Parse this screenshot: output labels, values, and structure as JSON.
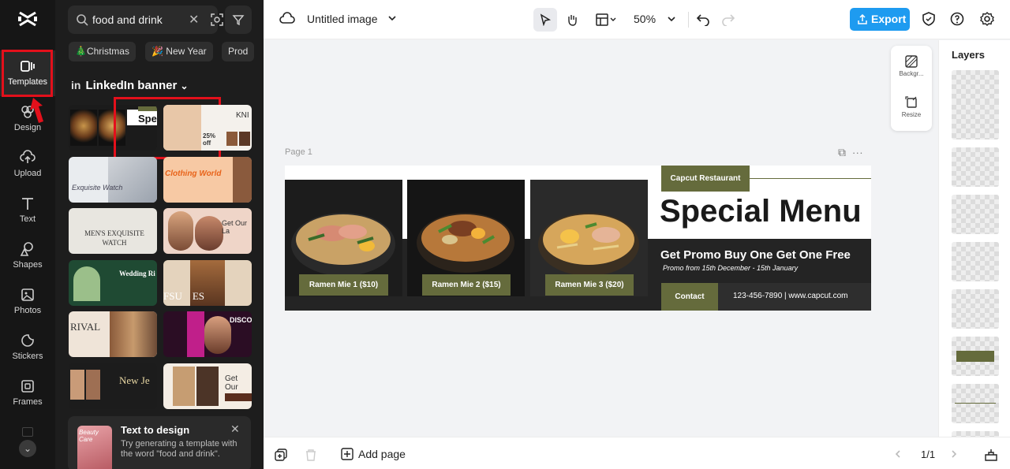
{
  "sidebar": {
    "items": [
      {
        "label": "Templates",
        "icon": "templates-icon"
      },
      {
        "label": "Design",
        "icon": "design-icon"
      },
      {
        "label": "Upload",
        "icon": "upload-icon"
      },
      {
        "label": "Text",
        "icon": "text-icon"
      },
      {
        "label": "Shapes",
        "icon": "shapes-icon"
      },
      {
        "label": "Photos",
        "icon": "photos-icon"
      },
      {
        "label": "Stickers",
        "icon": "stickers-icon"
      },
      {
        "label": "Frames",
        "icon": "frames-icon"
      }
    ]
  },
  "panel": {
    "search_value": "food and drink",
    "chips": [
      "🎄Christmas",
      "🎉 New Year",
      "Prod"
    ],
    "category": "LinkedIn banner",
    "thumbs": [
      {
        "text": "Spec"
      },
      {
        "text": "KNI"
      },
      {
        "text": "Exquisite Watch"
      },
      {
        "text": "Clothing World"
      },
      {
        "text": "MEN'S EXQUISITE WATCH"
      },
      {
        "text": "Get Our La"
      },
      {
        "text": "Wedding Ri"
      },
      {
        "text": "FSU    ES"
      },
      {
        "text": "RIVAL"
      },
      {
        "text": "DISCOU"
      },
      {
        "text": "New Je"
      },
      {
        "text": "Get Our"
      }
    ],
    "text_to_design": {
      "title": "Text to design",
      "description": "Try generating a template with the word \"food and drink\".",
      "image_text": "Beauty Care"
    }
  },
  "topbar": {
    "title": "Untitled image",
    "zoom": "50%",
    "export_label": "Export"
  },
  "canvas": {
    "page_label": "Page 1",
    "side_tools": [
      "Backgr...",
      "Resize"
    ]
  },
  "design": {
    "restaurant": "Capcut Restaurant",
    "headline": "Special Menu",
    "promo": "Get Promo Buy One Get One Free",
    "promo_sub": "Promo from 15th December - 15th January",
    "contact_label": "Contact",
    "contact_info": "123-456-7890 | www.capcut.com",
    "captions": [
      "Ramen Mie 1 ($10)",
      "Ramen Mie 2 ($15)",
      "Ramen Mie 3 ($20)"
    ]
  },
  "layers": {
    "title": "Layers"
  },
  "bottombar": {
    "add_page": "Add page",
    "pager": "1/1"
  },
  "colors": {
    "accent_blue": "#1e9bf0",
    "olive": "#656b3c",
    "highlight_red": "#e3101b"
  }
}
